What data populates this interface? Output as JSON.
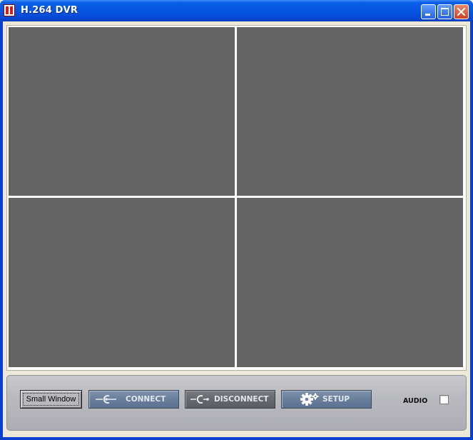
{
  "window": {
    "title": "H.264 DVR",
    "controls": {
      "minimize_icon": "minimize-icon",
      "maximize_icon": "maximize-icon",
      "close_icon": "close-icon"
    }
  },
  "video_grid": {
    "cells": [
      "",
      "",
      "",
      ""
    ]
  },
  "controls_panel": {
    "small_window_label": "Small Window",
    "connect_label": "CONNECT",
    "disconnect_label": "DISCONNECT",
    "setup_label": "SETUP",
    "audio_label": "AUDIO",
    "audio_checked": false
  },
  "colors": {
    "titlebar": "#0655e0",
    "video_cell": "#646464",
    "button_blue": "#6b809c",
    "button_gray": "#67696f"
  }
}
